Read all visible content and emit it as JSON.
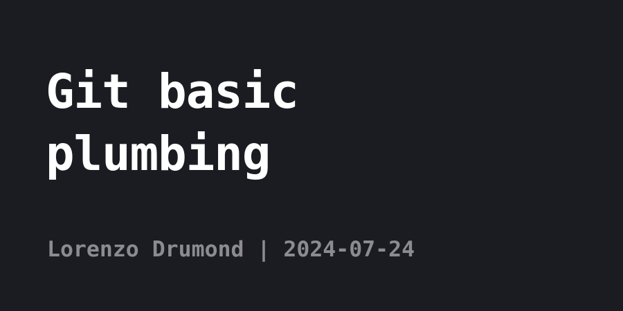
{
  "post": {
    "title_lines": [
      "Git basic",
      "plumbing"
    ],
    "author": "Lorenzo Drumond",
    "separator": " | ",
    "date": "2024-07-24"
  },
  "colors": {
    "background": "#1b1b22",
    "title": "#ffffff",
    "meta": "#8b8b90"
  }
}
